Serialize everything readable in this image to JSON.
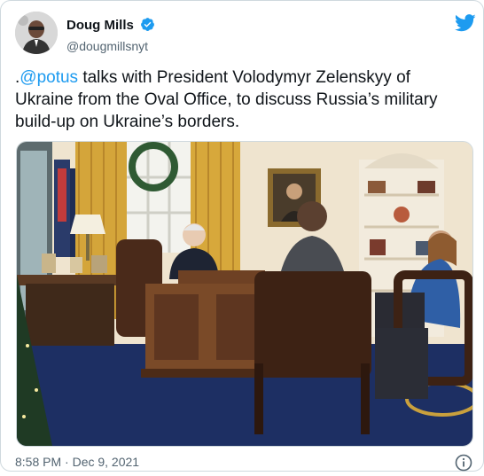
{
  "tweet": {
    "display_name": "Doug Mills",
    "handle": "@dougmillsnyt",
    "text_prefix": ".",
    "mention": "@potus",
    "text_body": " talks with President Volodymyr Zelenskyy of Ukraine from the Oval Office, to discuss Russia’s military build-up on Ukraine’s borders.",
    "timestamp": "8:58 PM · Dec 9, 2021"
  },
  "icons": {
    "verified": "verified-badge-icon",
    "logo": "twitter-bird-icon",
    "info": "info-icon"
  },
  "colors": {
    "accent": "#1d9bf0",
    "text": "#0f1419",
    "muted": "#536471"
  }
}
